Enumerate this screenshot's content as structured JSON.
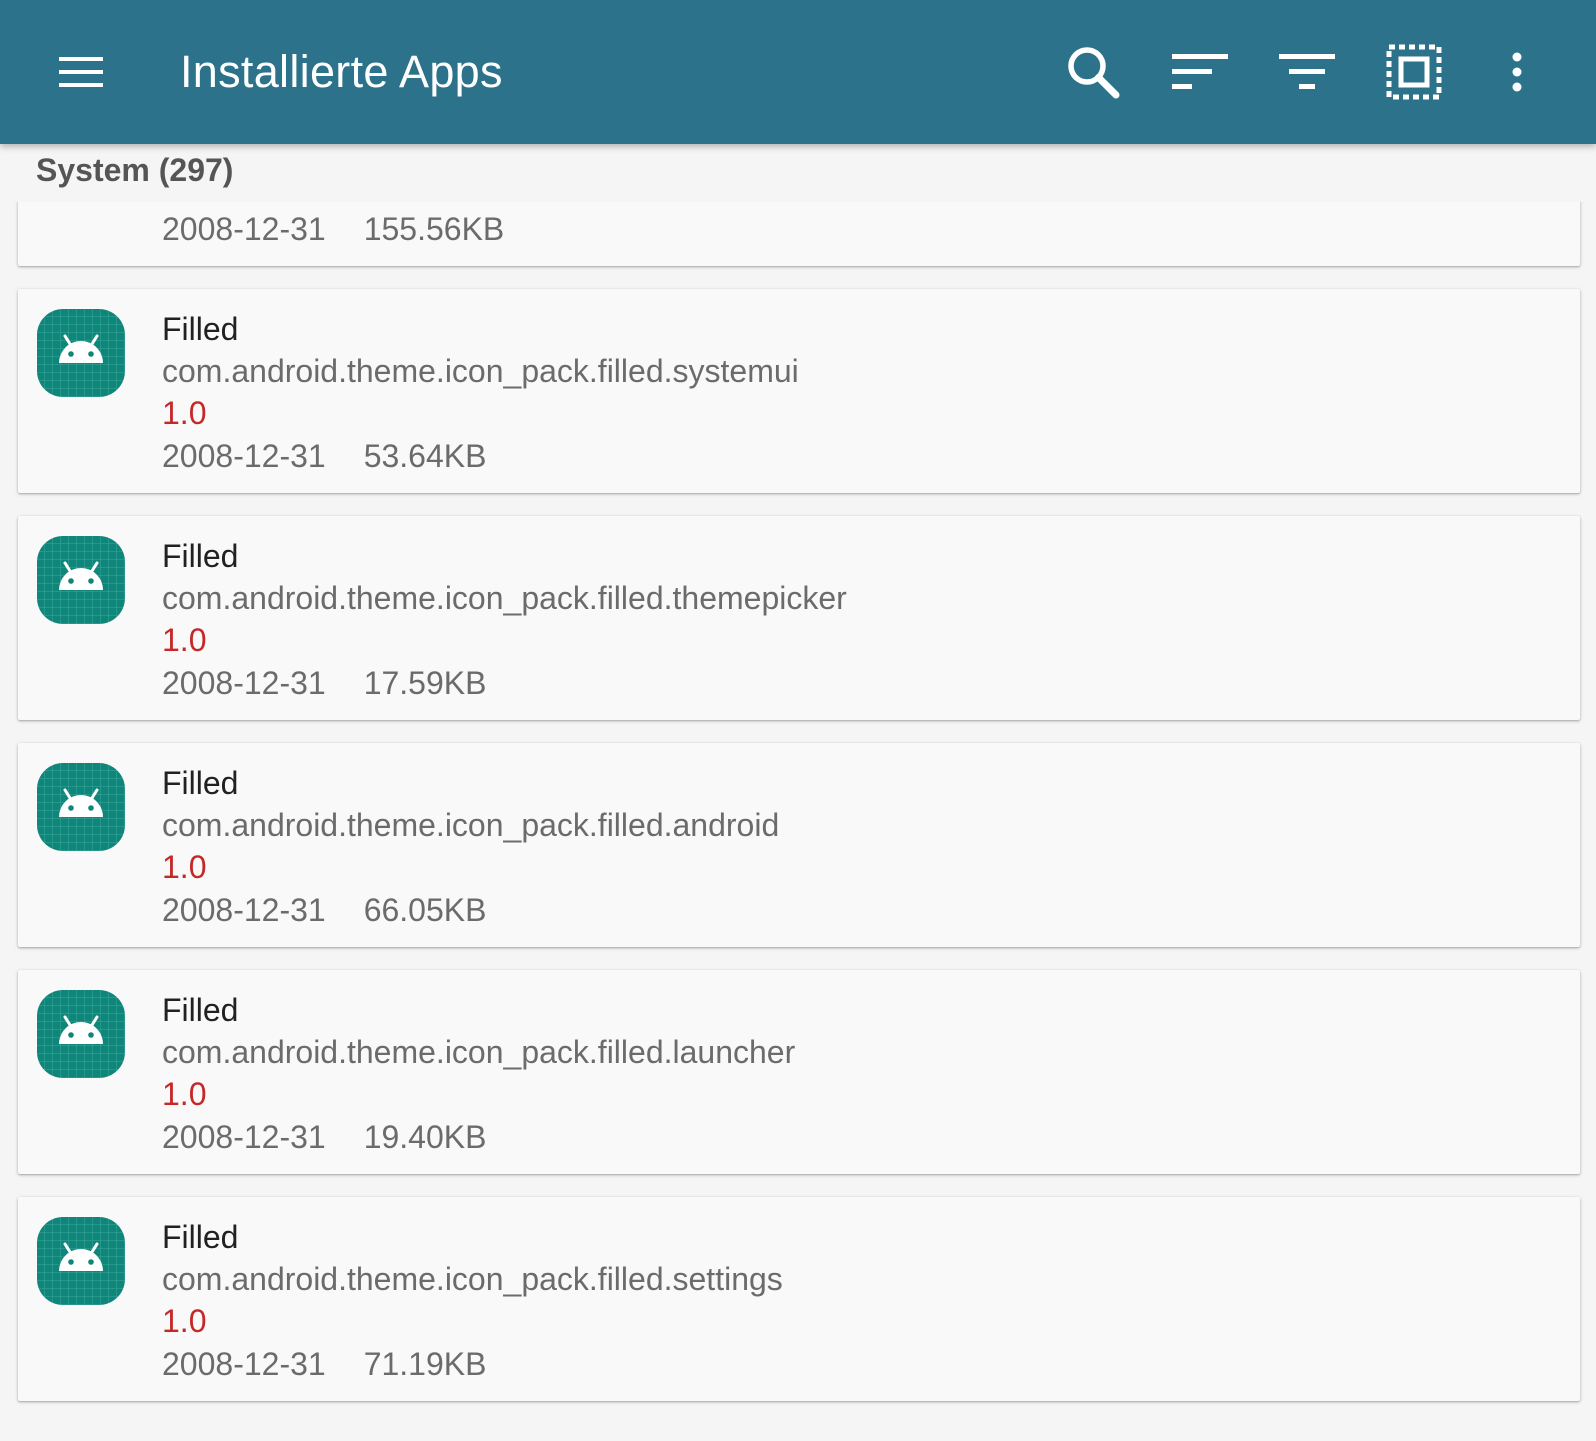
{
  "appbar": {
    "title": "Installierte Apps",
    "color": "#2c728a",
    "icons": [
      "menu-icon",
      "search-icon",
      "sort-icon",
      "filter-icon",
      "select-all-icon",
      "more-vert-icon"
    ]
  },
  "section": {
    "label": "System (297)"
  },
  "partial_item": {
    "date": "2008-12-31",
    "size": "155.56KB"
  },
  "apps": [
    {
      "name": "Filled",
      "package": "com.android.theme.icon_pack.filled.systemui",
      "version": "1.0",
      "date": "2008-12-31",
      "size": "53.64KB",
      "icon": "android-app-icon"
    },
    {
      "name": "Filled",
      "package": "com.android.theme.icon_pack.filled.themepicker",
      "version": "1.0",
      "date": "2008-12-31",
      "size": "17.59KB",
      "icon": "android-app-icon"
    },
    {
      "name": "Filled",
      "package": "com.android.theme.icon_pack.filled.android",
      "version": "1.0",
      "date": "2008-12-31",
      "size": "66.05KB",
      "icon": "android-app-icon"
    },
    {
      "name": "Filled",
      "package": "com.android.theme.icon_pack.filled.launcher",
      "version": "1.0",
      "date": "2008-12-31",
      "size": "19.40KB",
      "icon": "android-app-icon"
    },
    {
      "name": "Filled",
      "package": "com.android.theme.icon_pack.filled.settings",
      "version": "1.0",
      "date": "2008-12-31",
      "size": "71.19KB",
      "icon": "android-app-icon"
    }
  ],
  "colors": {
    "version_text": "#c62828",
    "icon_bg": "#10857a"
  }
}
